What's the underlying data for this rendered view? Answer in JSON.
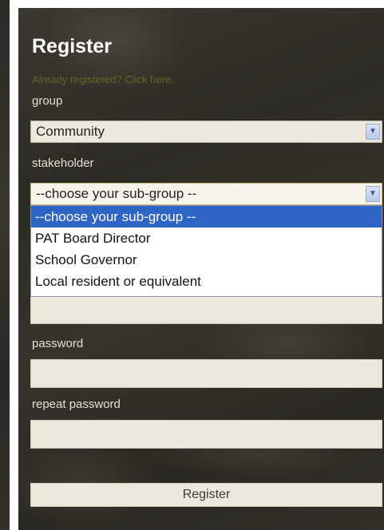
{
  "form": {
    "title": "Register",
    "login_link": "Already registered? Click here.",
    "group_label": "group",
    "group_value": "Community",
    "stakeholder_label": "stakeholder",
    "stakeholder_value": "--choose your sub-group --",
    "stakeholder_options": [
      "--choose your sub-group --",
      "PAT Board Director",
      "School Governor",
      "Local resident or equivalent"
    ],
    "password_label": "password",
    "repeat_password_label": "repeat password",
    "submit_label": "Register"
  },
  "icons": {
    "dropdown_arrow": "chevron-down-icon"
  },
  "colors": {
    "panel_background": "#33302a",
    "link_color": "#6e7d1e",
    "selected_option": "#2f66c6",
    "field_background": "#ece8dc"
  }
}
